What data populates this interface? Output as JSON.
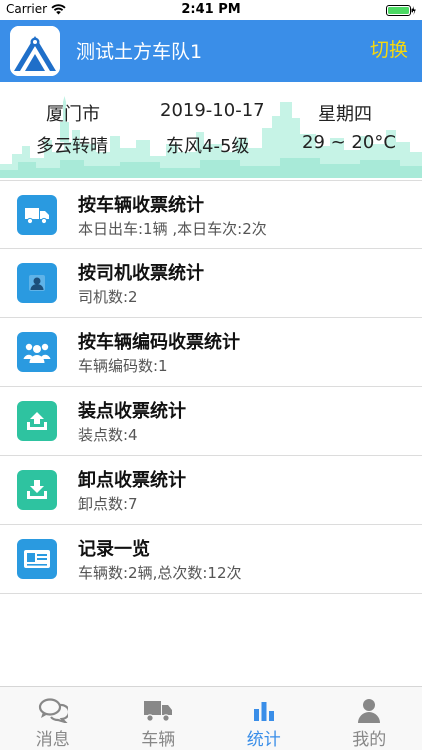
{
  "status_bar": {
    "carrier": "Carrier",
    "time": "2:41 PM"
  },
  "header": {
    "title": "测试土方车队1",
    "switch_label": "切换"
  },
  "weather": {
    "city": "厦门市",
    "date": "2019-10-17",
    "weekday": "星期四",
    "condition": "多云转晴",
    "wind": "东风4-5级",
    "temperature": "29 ~ 20°C"
  },
  "menu": [
    {
      "label": "按车辆收票统计",
      "sub": "本日出车:1辆 ,本日车次:2次",
      "icon": "truck-icon",
      "color": "#2a9ae0"
    },
    {
      "label": "按司机收票统计",
      "sub": "司机数:2",
      "icon": "person-icon",
      "color": "#2a9ae0"
    },
    {
      "label": "按车辆编码收票统计",
      "sub": "车辆编码数:1",
      "icon": "group-icon",
      "color": "#2a9ae0"
    },
    {
      "label": "装点收票统计",
      "sub": "装点数:4",
      "icon": "upload-icon",
      "color": "#2ec3a0"
    },
    {
      "label": "卸点收票统计",
      "sub": "卸点数:7",
      "icon": "download-icon",
      "color": "#2ec3a0"
    },
    {
      "label": "记录一览",
      "sub": "车辆数:2辆,总次数:12次",
      "icon": "id-card-icon",
      "color": "#2a9ae0"
    }
  ],
  "tabs": [
    {
      "label": "消息",
      "icon": "chat-icon"
    },
    {
      "label": "车辆",
      "icon": "truck-icon"
    },
    {
      "label": "统计",
      "icon": "bar-chart-icon",
      "active": true
    },
    {
      "label": "我的",
      "icon": "user-icon"
    }
  ],
  "colors": {
    "header": "#3a8ee8",
    "switch": "#f5d80f",
    "active_tab": "#3a8ee8",
    "skyline": "#a8ead8"
  }
}
